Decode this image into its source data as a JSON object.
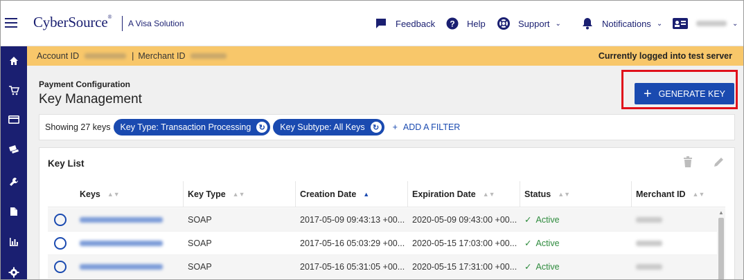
{
  "header": {
    "brand": "CyberSource",
    "brand_mark": "®",
    "brand_sub": "A Visa Solution",
    "feedback_label": "Feedback",
    "help_label": "Help",
    "support_label": "Support",
    "notifications_label": "Notifications"
  },
  "rail": {
    "icons": [
      "home-icon",
      "cart-icon",
      "card-icon",
      "payment-icon",
      "wrench-icon",
      "document-icon",
      "chart-icon",
      "settings-icon"
    ]
  },
  "banner": {
    "account_label": "Account ID",
    "separator": "|",
    "merchant_label": "Merchant ID",
    "server_status": "Currently logged into test server",
    "color": "#f8c76a"
  },
  "page": {
    "section": "Payment Configuration",
    "title": "Key Management",
    "generate_label": "GENERATE KEY"
  },
  "filters": {
    "showing": "Showing 27 keys",
    "chips": [
      "Key Type: Transaction Processing",
      "Key Subtype: All Keys"
    ],
    "add_filter": "ADD A FILTER"
  },
  "key_list": {
    "title": "Key List",
    "columns": [
      "Keys",
      "Key Type",
      "Creation Date",
      "Expiration Date",
      "Status",
      "Merchant ID"
    ],
    "sorted_column": "Creation Date",
    "sort_direction": "ascending",
    "rows": [
      {
        "key_type": "SOAP",
        "creation_date": "2017-05-09 09:43:13 +00...",
        "expiration_date": "2020-05-09 09:43:00 +00...",
        "status": "Active"
      },
      {
        "key_type": "SOAP",
        "creation_date": "2017-05-16 05:03:29 +00...",
        "expiration_date": "2020-05-15 17:03:00 +00...",
        "status": "Active"
      },
      {
        "key_type": "SOAP",
        "creation_date": "2017-05-16 05:31:05 +00...",
        "expiration_date": "2020-05-15 17:31:00 +00...",
        "status": "Active"
      }
    ]
  },
  "colors": {
    "brand_navy": "#1a1f71",
    "primary_blue": "#1a4ab0",
    "highlight_red": "#e0101a",
    "active_green": "#2e8b3d"
  }
}
